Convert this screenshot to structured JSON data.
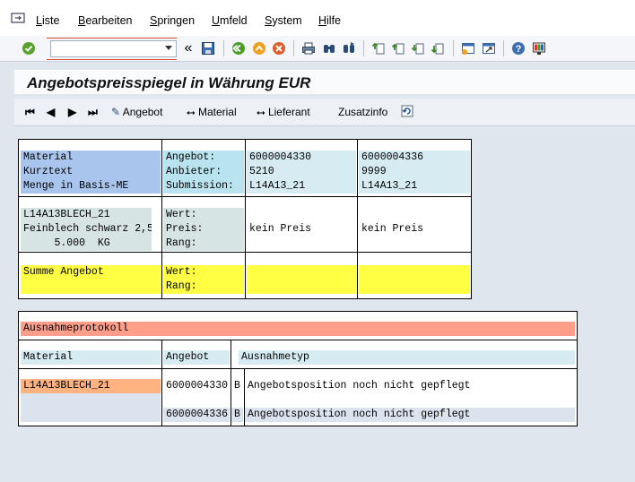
{
  "menu": {
    "items": [
      {
        "label": "Liste",
        "key": "liste"
      },
      {
        "label": "Bearbeiten",
        "key": "bearbeiten"
      },
      {
        "label": "Springen",
        "key": "springen"
      },
      {
        "label": "Umfeld",
        "key": "umfeld"
      },
      {
        "label": "System",
        "key": "system"
      },
      {
        "label": "Hilfe",
        "key": "hilfe"
      }
    ]
  },
  "toolbar": {
    "command_value": "",
    "collapse_label": "«",
    "icons": [
      "enter-check-icon",
      "save-icon",
      "back-icon",
      "exit-icon",
      "cancel-icon",
      "print-icon",
      "find-icon",
      "find-next-icon",
      "first-page-icon",
      "previous-page-icon",
      "next-page-icon",
      "last-page-icon",
      "create-session-icon",
      "shortcut-icon",
      "help-icon",
      "customize-layout-icon"
    ]
  },
  "title": "Angebotspreisspiegel in Währung EUR",
  "app_toolbar": {
    "first_label": "⏮",
    "prev_label": "◀",
    "next_label": "▶",
    "last_label": "⏭",
    "angebot_label": "Angebot",
    "material_label": "Material",
    "lieferant_label": "Lieferant",
    "zusatzinfo_label": "Zusatzinfo"
  },
  "comparison": {
    "header_left": [
      "Material",
      "Kurztext",
      "Menge in Basis-ME"
    ],
    "header_mid": [
      "Angebot:",
      "Anbieter:",
      "Submission:"
    ],
    "quotations": [
      {
        "angebot": "6000004330",
        "anbieter": "5210",
        "submission": "L14A13_21",
        "preis": "kein Preis"
      },
      {
        "angebot": "6000004336",
        "anbieter": "9999",
        "submission": "L14A13_21",
        "preis": "kein Preis"
      }
    ],
    "material_block": [
      "L14A13BLECH_21",
      "Feinblech schwarz 2,5",
      "     5.000  KG"
    ],
    "material_labels": [
      "Wert:",
      "Preis:",
      "Rang:"
    ],
    "summary_label": "Summe Angebot",
    "summary_labels": [
      "Wert:",
      "Rang:"
    ]
  },
  "exceptions": {
    "title": "Ausnahmeprotokoll",
    "headers": {
      "material": "Material",
      "angebot": "Angebot",
      "typ": "Ausnahmetyp"
    },
    "rows": [
      {
        "material": "L14A13BLECH_21",
        "angebot": "6000004330",
        "code": "B",
        "typ": "Angebotsposition noch nicht gepflegt"
      },
      {
        "material": "",
        "angebot": "6000004336",
        "code": "B",
        "typ": "Angebotsposition noch nicht gepflegt"
      }
    ]
  },
  "colors": {
    "blue": "#a9c5ee",
    "cyan": "#b9e3ef",
    "yellow": "#ffff44",
    "salmon": "#ff9e8a",
    "orange": "#ffb380"
  }
}
